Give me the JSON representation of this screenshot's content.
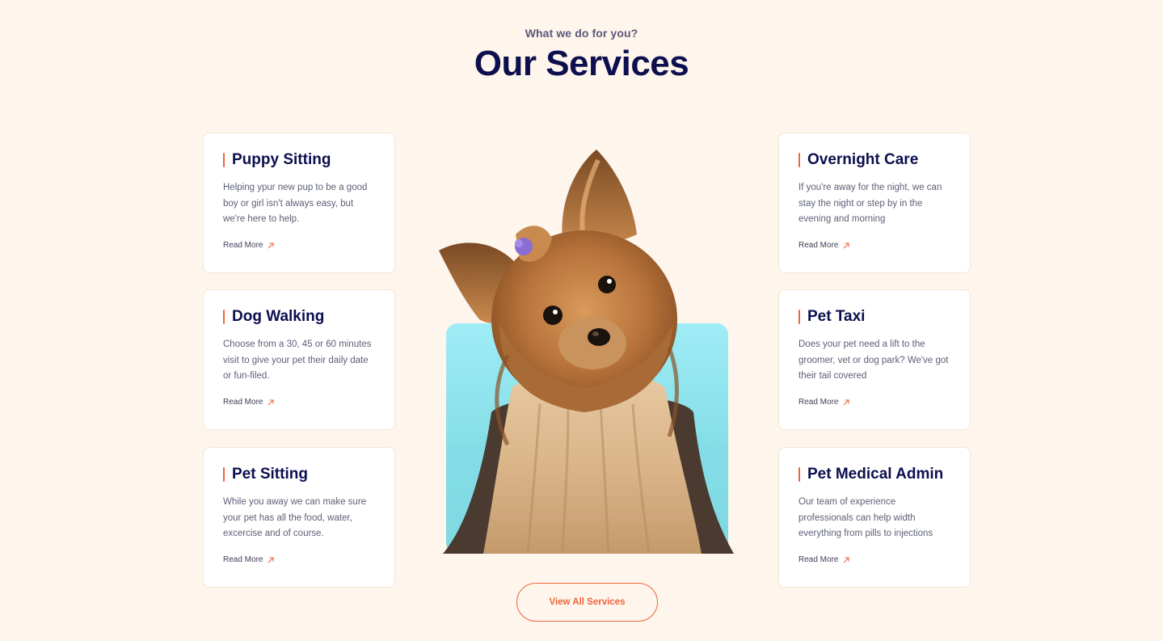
{
  "header": {
    "eyebrow": "What we do for you?",
    "title": "Our Services"
  },
  "services_left": [
    {
      "title": "Puppy Sitting",
      "description": "Helping ypur new pup to be a good boy or girl isn't always easy, but we're here to help.",
      "link_label": "Read More"
    },
    {
      "title": "Dog Walking",
      "description": "Choose from a 30, 45 or 60 minutes visit to give your pet their daily date or fun-filed.",
      "link_label": "Read More"
    },
    {
      "title": "Pet Sitting",
      "description": "While you away we can make sure your pet has all the food, water, excercise and of course.",
      "link_label": "Read More"
    }
  ],
  "services_right": [
    {
      "title": "Overnight Care",
      "description": "If you're away for the night, we can stay the night or step by in the evening and morning",
      "link_label": "Read More"
    },
    {
      "title": "Pet Taxi",
      "description": "Does your pet need a lift to the groomer, vet or dog park? We've got their tail covered",
      "link_label": "Read More"
    },
    {
      "title": "Pet Medical Admin",
      "description": "Our team of experience professionals can help width everything from pills to injections",
      "link_label": "Read More"
    }
  ],
  "cta": {
    "label": "View All Services"
  },
  "colors": {
    "background": "#fef5ec",
    "heading": "#0d0f4f",
    "accent": "#f0643a",
    "hero_bg": "#8fe3ec"
  },
  "icons": {
    "read_more": "arrow-up-right-icon",
    "title_marker": "accent-bar"
  }
}
